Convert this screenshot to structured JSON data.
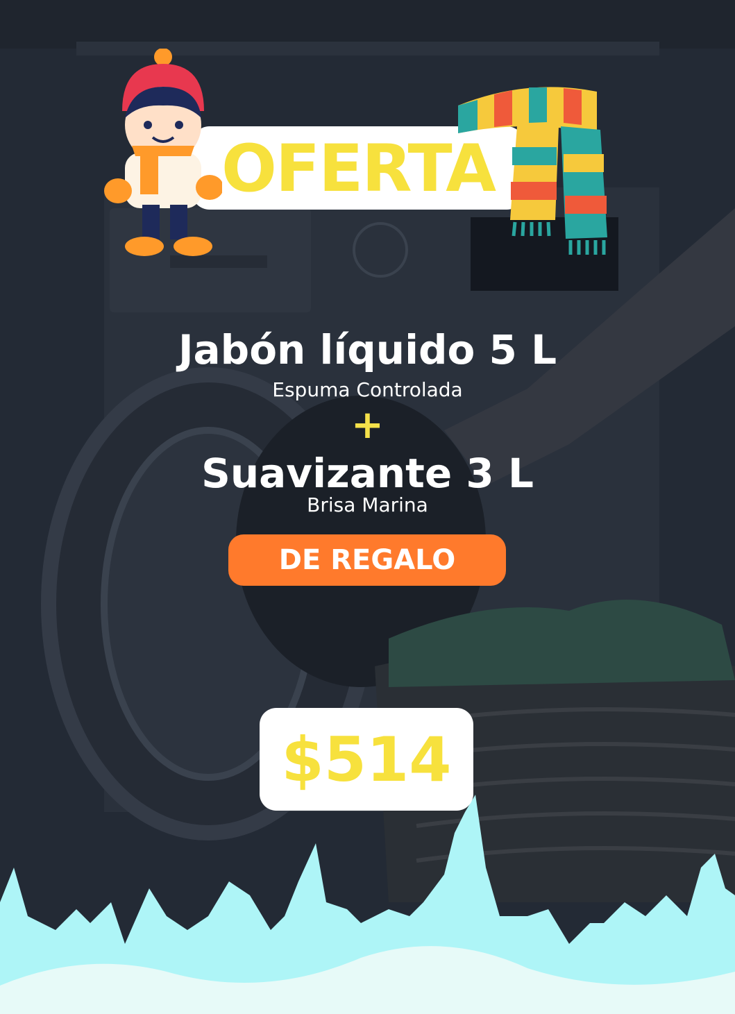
{
  "promo": {
    "banner_title": "OFERTA",
    "product_main": "Jabón líquido 5 L",
    "product_main_variant": "Espuma Controlada",
    "plus_sign": "+",
    "product_gift": "Suavizante 3 L",
    "product_gift_variant": "Brisa Marina",
    "gift_label": "DE REGALO",
    "price": "$514"
  },
  "colors": {
    "accent_yellow": "#f7e13d",
    "badge_orange": "#ff7a2c",
    "background_dark": "#232a35",
    "wave_cyan": "#aef5f7"
  },
  "decorations": {
    "left_illustration": "winter-kid-icon",
    "right_illustration": "striped-scarf-icon"
  }
}
